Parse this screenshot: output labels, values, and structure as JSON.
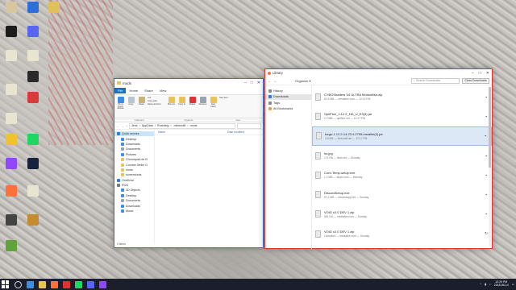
{
  "desktop_icons": [
    {
      "label": "",
      "color": "#d6c7a1"
    },
    {
      "label": "",
      "color": "#2d6fd8"
    },
    {
      "label": "",
      "color": "#e0c05a"
    },
    {
      "label": "",
      "color": "#1c1c1c"
    },
    {
      "label": "",
      "color": "#5865f2"
    },
    {
      "label": "",
      "color": "#e9e4d0"
    },
    {
      "label": "",
      "color": "#e9e4d0"
    },
    {
      "label": "",
      "color": "#2a2a2a"
    },
    {
      "label": "",
      "color": "#e9e4d0"
    },
    {
      "label": "",
      "color": "#d63c3c"
    },
    {
      "label": "",
      "color": "#e9e4d0"
    },
    {
      "label": "",
      "color": "#f0c32d"
    },
    {
      "label": "",
      "color": "#1ed760"
    },
    {
      "label": "",
      "color": "#9146ff"
    },
    {
      "label": "",
      "color": "#17223b"
    },
    {
      "label": "",
      "color": "#ff7139"
    },
    {
      "label": "",
      "color": "#e9e4d0"
    },
    {
      "label": "",
      "color": "#444"
    },
    {
      "label": "",
      "color": "#c48b2f"
    },
    {
      "label": "",
      "color": "#5fa33a"
    }
  ],
  "explorer": {
    "title": "mods",
    "tabs": [
      "File",
      "Home",
      "Share",
      "View"
    ],
    "ribbon": {
      "pin": "Pin to Quick access",
      "copy": "Copy",
      "paste": "Paste",
      "cut": "Cut",
      "copy_path": "Copy path",
      "paste_shortcut": "Paste shortcut",
      "move_to": "Move to",
      "copy_to": "Copy to",
      "delete": "Delete",
      "rename": "Rename",
      "new_folder": "New folder",
      "new_item": "New item",
      "groups": [
        "Clipboard",
        "Organize",
        "New"
      ]
    },
    "path": [
      "Jens",
      "AppData",
      "Roaming",
      ".minecraft",
      "mods"
    ],
    "columns": {
      "name": "Name",
      "date": "Date modified"
    },
    "nav": [
      {
        "label": "Quick access",
        "sub": false,
        "color": "#2d7be0",
        "sel": true
      },
      {
        "label": "Desktop",
        "sub": true,
        "color": "#3a8ee6",
        "sel": false
      },
      {
        "label": "Downloads",
        "sub": true,
        "color": "#3a8ee6",
        "sel": false
      },
      {
        "label": "Documents",
        "sub": true,
        "color": "#9aa4b0",
        "sel": false
      },
      {
        "label": "Pictures",
        "sub": true,
        "color": "#3a8ee6",
        "sel": false
      },
      {
        "label": "Chroniques de B",
        "sub": true,
        "color": "#e8c35a",
        "sel": false
      },
      {
        "label": "Counter-Strike G",
        "sub": true,
        "color": "#e8c35a",
        "sel": false
      },
      {
        "label": "mods",
        "sub": true,
        "color": "#e8c35a",
        "sel": false
      },
      {
        "label": "screenshots",
        "sub": true,
        "color": "#e8c35a",
        "sel": false
      },
      {
        "label": "OneDrive",
        "sub": false,
        "color": "#2d7be0",
        "sel": false
      },
      {
        "label": "ROG",
        "sub": false,
        "color": "#6e7a88",
        "sel": false
      },
      {
        "label": "3D Objects",
        "sub": true,
        "color": "#3a8ee6",
        "sel": false
      },
      {
        "label": "Desktop",
        "sub": true,
        "color": "#3a8ee6",
        "sel": false
      },
      {
        "label": "Documents",
        "sub": true,
        "color": "#9aa4b0",
        "sel": false
      },
      {
        "label": "Downloads",
        "sub": true,
        "color": "#3a8ee6",
        "sel": false
      },
      {
        "label": "Music",
        "sub": true,
        "color": "#3a8ee6",
        "sel": false
      }
    ],
    "status": "0 items"
  },
  "library": {
    "title": "Library",
    "organize": "Organize",
    "search_placeholder": "Search Downloads",
    "clear": "Clear Downloads",
    "side": [
      {
        "label": "History",
        "color": "#888",
        "sel": false
      },
      {
        "label": "Downloads",
        "color": "#2d7be0",
        "sel": true
      },
      {
        "label": "Tags",
        "color": "#888",
        "sel": false
      },
      {
        "label": "All Bookmarks",
        "color": "#e8a33a",
        "sel": false
      }
    ],
    "items": [
      {
        "name": "CYBOShaders V4 ULTRA MotionBlur.zip",
        "meta": "82.5 MB — mediafire.com — 12:19 PM",
        "sel": false,
        "action": "folder"
      },
      {
        "name": "OptiFine_1.12.2_HD_U_E3(3).jar",
        "meta": "2.2 MB — optifine.net — 12:17 PM",
        "sel": false,
        "action": "folder"
      },
      {
        "name": "forge-1.12.2-14.23.4.2705-installer(2).jar",
        "meta": "4.8 MB — forecraft.net — 12:17 PM",
        "sel": true,
        "action": "folder"
      },
      {
        "name": "hs.jpg",
        "meta": "171 KB — flickr.net — Monday",
        "sel": false,
        "action": "folder"
      },
      {
        "name": "Core-Temp-setup.exe",
        "meta": "1.2 MB — alcpu.com — Monday",
        "sel": false,
        "action": "folder"
      },
      {
        "name": "DiscordSetup.exe",
        "meta": "57.2 MB — discordapp.net — Sunday",
        "sel": false,
        "action": "folder"
      },
      {
        "name": "VOID v2.0 DEV 1.zip",
        "meta": "561 KB — mediafire.com — Sunday",
        "sel": false,
        "action": "folder"
      },
      {
        "name": "VOID v2.0 DEV 1.zip",
        "meta": "Canceled — mediafire.com — Sunday",
        "sel": false,
        "action": "retry"
      },
      {
        "name": "",
        "meta": "",
        "sel": false,
        "action": "folder"
      }
    ]
  },
  "taskbar": {
    "time": "12:20 PM",
    "date": "2018-06-14",
    "apps": [
      {
        "color": "#3a8ee6"
      },
      {
        "color": "#e8c35a"
      },
      {
        "color": "#ff7139"
      },
      {
        "color": "#e03030"
      },
      {
        "color": "#1ed760"
      },
      {
        "color": "#5865f2"
      },
      {
        "color": "#9146ff"
      }
    ]
  }
}
